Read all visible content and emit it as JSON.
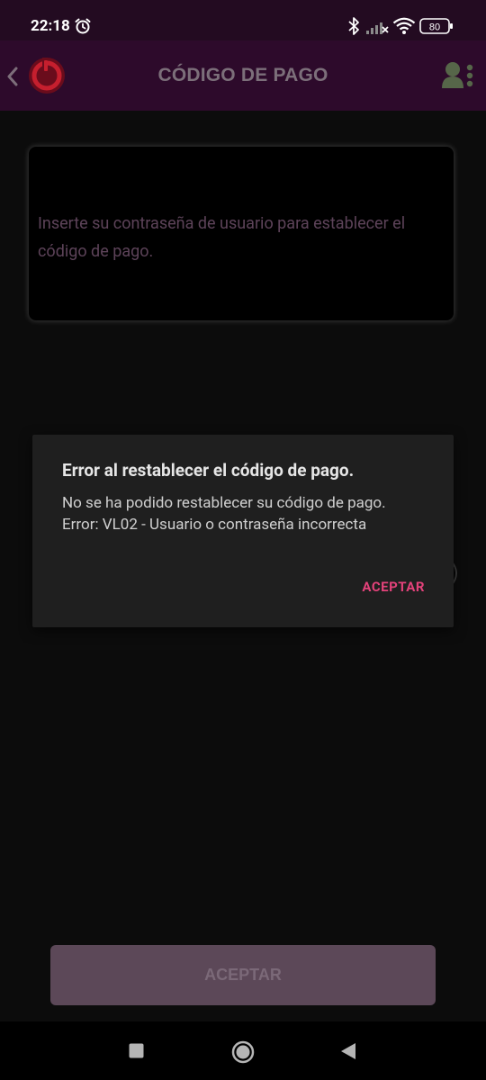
{
  "status_bar": {
    "time": "22:18",
    "battery_level": "80",
    "icons": [
      "alarm-icon",
      "bluetooth-icon",
      "cellular-signal-off-icon",
      "wifi-icon",
      "battery-icon"
    ]
  },
  "header": {
    "title": "CÓDIGO DE PAGO",
    "icons": [
      "back-arrow-icon",
      "app-logo",
      "user-settings-icon"
    ]
  },
  "content": {
    "instructions": "Inserte su contraseña de usuario para establecer el código de pago.",
    "accept_label": "ACEPTAR"
  },
  "dialog": {
    "title": "Error al restablecer el código de pago.",
    "message_line1": "No se ha podido restablecer su código de pago.",
    "message_line2": "Error: VL02 - Usuario o contraseña incorrecta",
    "button_label": "ACEPTAR"
  },
  "nav_bar": {
    "icons": [
      "recent-apps-icon",
      "home-icon",
      "back-icon"
    ]
  },
  "colors": {
    "header_background": "#2d0a2b",
    "status_background": "#230b21",
    "dialog_accent": "#e3427a",
    "disabled_button": "#5c4858",
    "muted_text": "#5d4359"
  }
}
